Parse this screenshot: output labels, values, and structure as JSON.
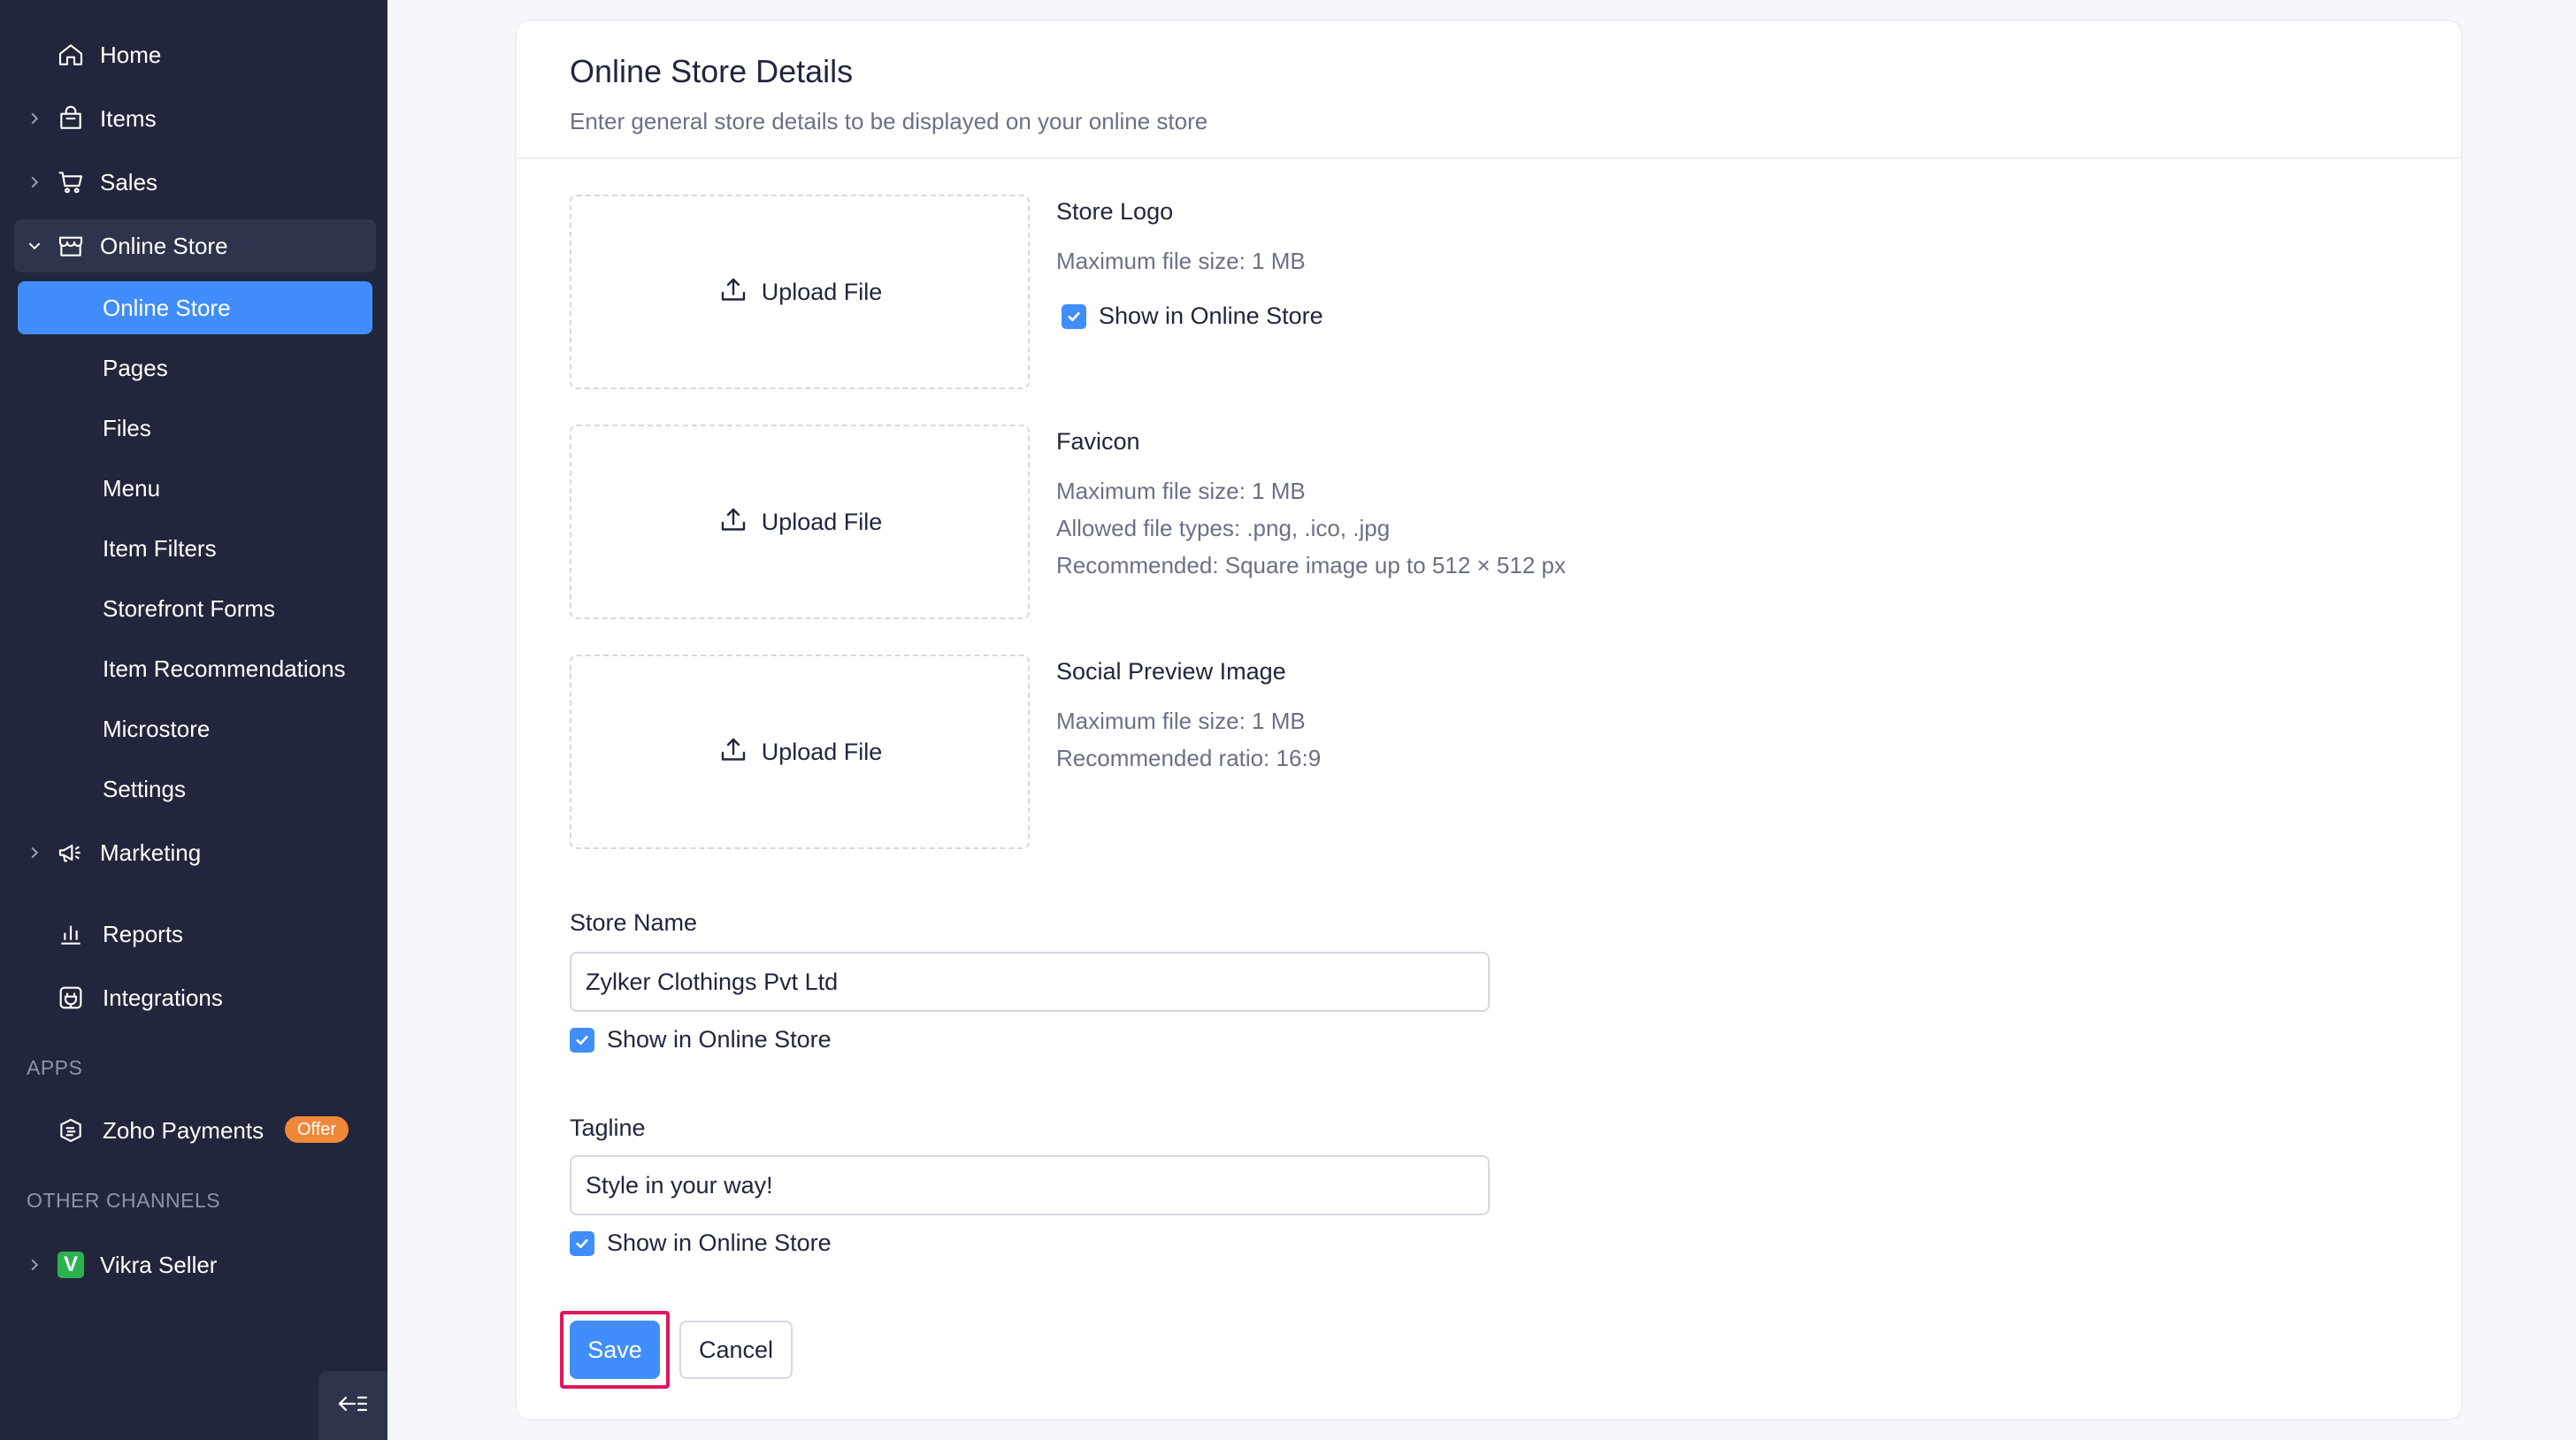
{
  "sidebar": {
    "items": [
      {
        "label": "Home",
        "icon": "home-icon"
      },
      {
        "label": "Items",
        "icon": "shopping-bag-icon"
      },
      {
        "label": "Sales",
        "icon": "cart-icon"
      },
      {
        "label": "Online Store",
        "icon": "storefront-icon",
        "expanded": true
      }
    ],
    "online_store_sub": [
      "Online Store",
      "Pages",
      "Files",
      "Menu",
      "Item Filters",
      "Storefront Forms",
      "Item Recommendations",
      "Microstore",
      "Settings"
    ],
    "marketing": "Marketing",
    "reports": "Reports",
    "integrations": "Integrations",
    "apps_heading": "APPS",
    "zoho_payments": "Zoho Payments",
    "offer_badge": "Offer",
    "other_channels_heading": "OTHER CHANNELS",
    "vikra_seller": "Vikra Seller",
    "vikra_logo_letter": "V"
  },
  "card": {
    "title": "Online Store Details",
    "subtitle": "Enter general store details to be displayed on your online store",
    "upload_label": "Upload File",
    "store_logo": {
      "title": "Store Logo",
      "max_size": "Maximum file size: 1 MB",
      "show_label": "Show in Online Store",
      "checked": true
    },
    "favicon": {
      "title": "Favicon",
      "max_size": "Maximum file size: 1 MB",
      "types": "Allowed file types: .png, .ico, .jpg",
      "recommended": "Recommended: Square image up to 512 × 512 px"
    },
    "social_preview": {
      "title": "Social Preview Image",
      "max_size": "Maximum file size: 1 MB",
      "ratio": "Recommended ratio: 16:9"
    },
    "store_name": {
      "label": "Store Name",
      "value": "Zylker Clothings Pvt Ltd",
      "show_label": "Show in Online Store",
      "checked": true
    },
    "tagline": {
      "label": "Tagline",
      "value": "Style in your way!",
      "show_label": "Show in Online Store",
      "checked": true
    },
    "save_label": "Save",
    "cancel_label": "Cancel"
  },
  "colors": {
    "sidebar_bg": "#21263c",
    "accent": "#408dfb",
    "highlight_outline": "#e0155b",
    "offer_badge": "#f0883a",
    "vikra_green": "#2bb24c"
  }
}
